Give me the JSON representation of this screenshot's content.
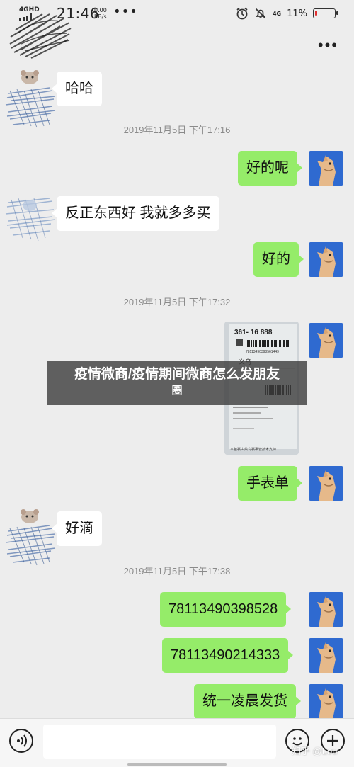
{
  "status_bar": {
    "network": "4GHD",
    "time": "21:46",
    "speed_value": "0.00",
    "speed_unit": "KB/s",
    "dots": "•••",
    "net_right": "4G",
    "battery": "11%",
    "battery_level": 0.11,
    "battery_color": "#e03030"
  },
  "header": {
    "more_label": "•••"
  },
  "messages": {
    "m1": "哈哈",
    "t1": "2019年11月5日 下午17:16",
    "m2": "好的呢",
    "m3": "反正东西好 我就多多买",
    "m4": "好的",
    "t2": "2019年11月5日 下午17:32",
    "photo": {
      "code": "361- 16 888",
      "label": "义乌",
      "barcode_number": "78113490398561449",
      "footer": "本包裹由菜鸟裹裹管技术支持"
    },
    "m5": "手表单",
    "m6": "好滴",
    "t3": "2019年11月5日 下午17:38",
    "m7": "78113490398528",
    "m8": "78113490214333",
    "m9": "统一凌晨发货"
  },
  "banner": {
    "line1": "疫情微商/疫情期间微商怎么发朋友",
    "line2": "圈"
  },
  "input_bar": {
    "placeholder": ""
  },
  "watermark": "知乎 @Lou",
  "colors": {
    "outgoing_bubble": "#95ec69",
    "incoming_bubble": "#ffffff",
    "background": "#ededed"
  }
}
